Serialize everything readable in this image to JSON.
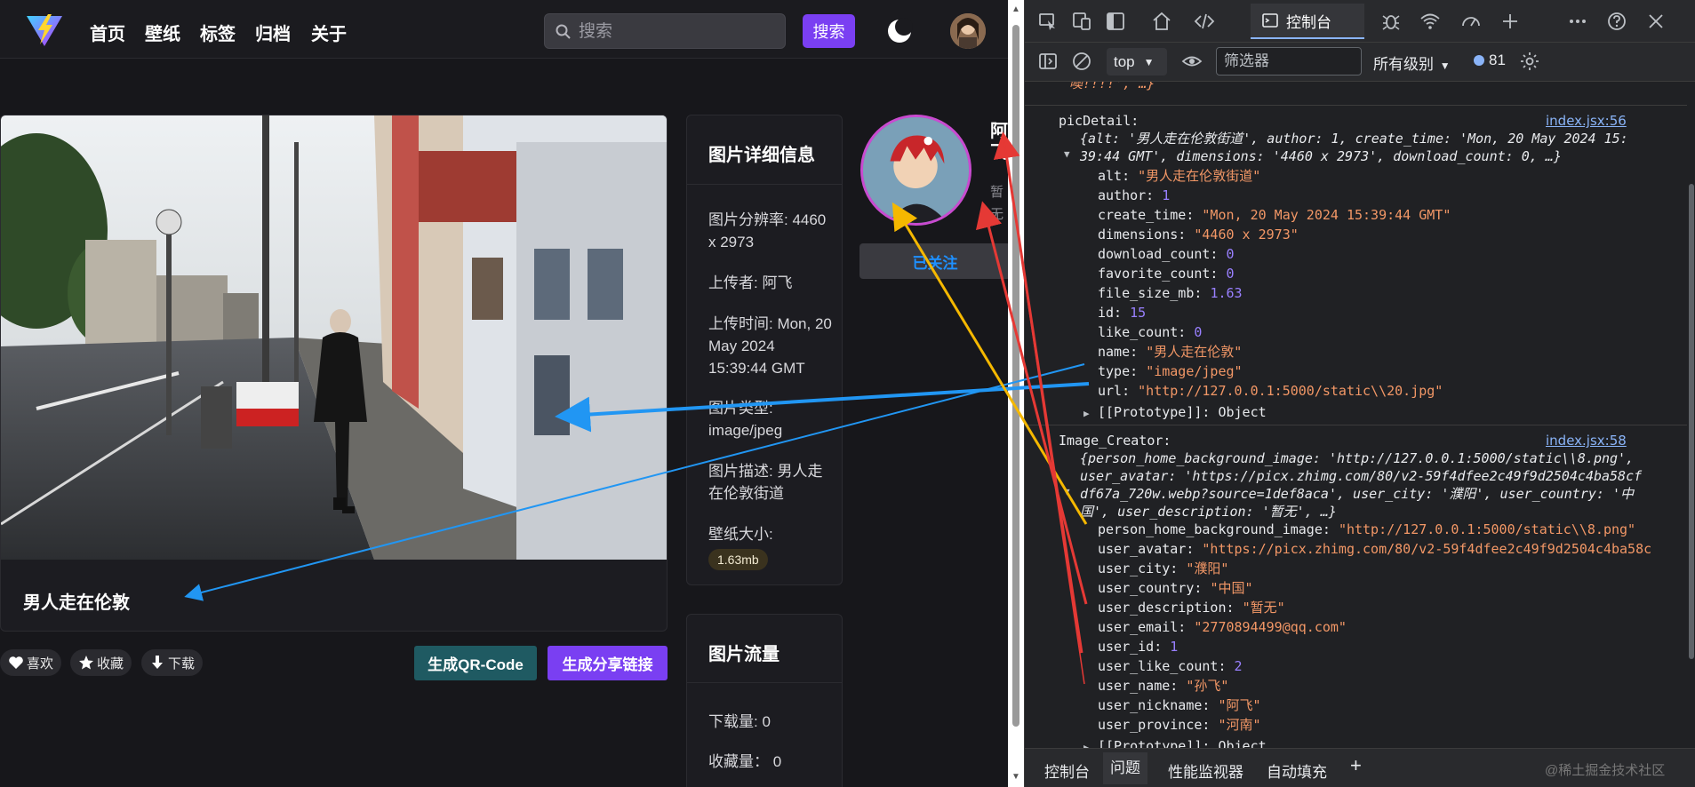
{
  "nav": {
    "links": [
      "首页",
      "壁纸",
      "标签",
      "归档",
      "关于"
    ],
    "search_placeholder": "搜索",
    "search_button": "搜索"
  },
  "photo": {
    "caption": "男人走在伦敦"
  },
  "actions": {
    "like": "喜欢",
    "favorite": "收藏",
    "download": "下载",
    "qr": "生成QR-Code",
    "share": "生成分享链接"
  },
  "info": {
    "title": "图片详细信息",
    "resolution": "图片分辨率: 4460 x 2973",
    "uploader": "上传者: 阿飞",
    "upload_time": "上传时间: Mon, 20 May 2024 15:39:44 GMT",
    "type": "图片类型: image/jpeg",
    "description": "图片描述: 男人走在伦敦街道",
    "size_label": "壁纸大小:",
    "size_value": "1.63mb"
  },
  "flow": {
    "title": "图片流量",
    "downloads": "下载量: 0",
    "favorites": "收藏量： 0"
  },
  "creator": {
    "name": "阿飞",
    "desc": "暂无",
    "follow": "已关注"
  },
  "devtools": {
    "console_tab": "控制台",
    "context": "top",
    "filter_placeholder": "筛选器",
    "levels": "所有级别",
    "message_count": "81",
    "drawer_tabs": [
      "控制台",
      "问题",
      "性能监视器",
      "自动填充"
    ],
    "watermark": "@稀土掘金技术社区"
  },
  "console": {
    "top_fragment": "噢!!!!', …}",
    "pic_label": "picDetail:",
    "pic_src": "index.jsx:56",
    "pic_summary_1": "{alt: '男人走在伦敦街道', author: 1, create_time: 'Mon, 20 May 2024 15:",
    "pic_summary_2": "39:44 GMT', dimensions: '4460 x 2973', download_count: 0, …}",
    "pic_fields": [
      {
        "k": "alt",
        "v": "\"男人走在伦敦街道\"",
        "t": "str"
      },
      {
        "k": "author",
        "v": "1",
        "t": "num"
      },
      {
        "k": "create_time",
        "v": "\"Mon, 20 May 2024 15:39:44 GMT\"",
        "t": "str"
      },
      {
        "k": "dimensions",
        "v": "\"4460 x 2973\"",
        "t": "str"
      },
      {
        "k": "download_count",
        "v": "0",
        "t": "num"
      },
      {
        "k": "favorite_count",
        "v": "0",
        "t": "num"
      },
      {
        "k": "file_size_mb",
        "v": "1.63",
        "t": "num"
      },
      {
        "k": "id",
        "v": "15",
        "t": "num"
      },
      {
        "k": "like_count",
        "v": "0",
        "t": "num"
      },
      {
        "k": "name",
        "v": "\"男人走在伦敦\"",
        "t": "str"
      },
      {
        "k": "type",
        "v": "\"image/jpeg\"",
        "t": "str"
      },
      {
        "k": "url",
        "v": "\"http://127.0.0.1:5000/static\\\\20.jpg\"",
        "t": "str"
      }
    ],
    "prototype": "[[Prototype]]: Object",
    "creator_label": "Image_Creator:",
    "creator_src": "index.jsx:58",
    "creator_summary_1": "{person_home_background_image: 'http://127.0.0.1:5000/static\\\\8.png',",
    "creator_summary_2": "user_avatar: 'https://picx.zhimg.com/80/v2-59f4dfee2c49f9d2504c4ba58cf",
    "creator_summary_3": "df67a_720w.webp?source=1def8aca', user_city: '濮阳', user_country: '中",
    "creator_summary_4": "国', user_description: '暂无', …}",
    "creator_fields": [
      {
        "k": "person_home_background_image",
        "v": "\"http://127.0.0.1:5000/static\\\\8.png\"",
        "t": "str"
      },
      {
        "k": "user_avatar",
        "v": "\"https://picx.zhimg.com/80/v2-59f4dfee2c49f9d2504c4ba58c",
        "t": "str"
      },
      {
        "k": "user_city",
        "v": "\"濮阳\"",
        "t": "str"
      },
      {
        "k": "user_country",
        "v": "\"中国\"",
        "t": "str"
      },
      {
        "k": "user_description",
        "v": "\"暂无\"",
        "t": "str"
      },
      {
        "k": "user_email",
        "v": "\"2770894499@qq.com\"",
        "t": "str"
      },
      {
        "k": "user_id",
        "v": "1",
        "t": "num"
      },
      {
        "k": "user_like_count",
        "v": "2",
        "t": "num"
      },
      {
        "k": "user_name",
        "v": "\"孙飞\"",
        "t": "str"
      },
      {
        "k": "user_nickname",
        "v": "\"阿飞\"",
        "t": "str"
      },
      {
        "k": "user_province",
        "v": "\"河南\"",
        "t": "str"
      }
    ]
  },
  "colors": {
    "accent": "#7a3ff2",
    "qr_button": "#1f5a62",
    "follow_text": "#1e90ff",
    "arrow_blue": "#2196f3",
    "arrow_red": "#e53935",
    "arrow_yellow": "#f5b800"
  }
}
